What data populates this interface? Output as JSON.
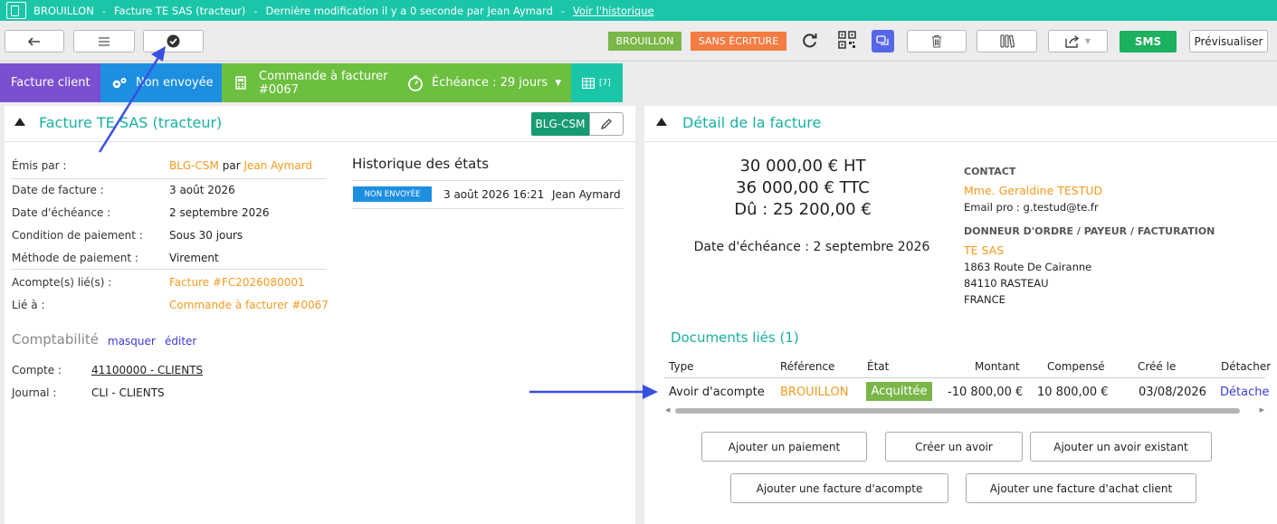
{
  "topbar": {
    "status": "BROUILLON",
    "sep1": "-",
    "title": "Facture TE SAS (tracteur)",
    "sep2": "-",
    "modified": "Dernière modification il y a 0 seconde par Jean Aymard",
    "sep3": "-",
    "history_link": "Voir l'historique"
  },
  "toolbar": {
    "badge_draft": "BROUILLON",
    "badge_no_write": "SANS ÉCRITURE",
    "sms": "SMS",
    "preview": "Prévisualiser",
    "colors": {
      "draft": "#7ab648",
      "no_write": "#f47b41",
      "sms": "#1bb15e",
      "chat": "#5567e8"
    }
  },
  "tabs": {
    "invoice_type": "Facture client",
    "send_state": "Non envoyée",
    "order_line1": "Commande à facturer",
    "order_line2": "#0067",
    "due": "Échéance : 29 jours",
    "grid_badge": "[7]",
    "colors": {
      "invoice_type": "#7b4fd1",
      "send_state": "#1d8fe0",
      "order": "#6cbf3f",
      "due": "#6cbf3f",
      "grid": "#1bc6a8"
    }
  },
  "left": {
    "title": "Facture TE SAS (tracteur)",
    "tag": "BLG-CSM",
    "fields": {
      "issued_by_label": "Émis par :",
      "issued_by_org": "BLG-CSM",
      "issued_by_par": "par",
      "issued_by_user": "Jean Aymard",
      "date_label": "Date de facture :",
      "date_value": "3 août 2026",
      "due_label": "Date d'échéance :",
      "due_value": "2 septembre 2026",
      "cond_label": "Condition de paiement :",
      "cond_value": "Sous 30 jours",
      "method_label": "Méthode de paiement :",
      "method_value": "Virement",
      "deposit_label": "Acompte(s) lié(s) :",
      "deposit_value": "Facture #FC2026080001",
      "linked_label": "Lié à :",
      "linked_value": "Commande à facturer #0067"
    },
    "history": {
      "title": "Historique des états",
      "badge": "NON ENVOYÉE",
      "date": "3 août 2026 16:21",
      "user": "Jean Aymard"
    },
    "accounting": {
      "title": "Comptabilité",
      "hide": "masquer",
      "edit": "éditer",
      "account_label": "Compte :",
      "account_value": "41100000 - CLIENTS",
      "journal_label": "Journal :",
      "journal_value": "CLI - CLIENTS"
    }
  },
  "right": {
    "title": "Détail de la facture",
    "ht": "30 000,00 € HT",
    "ttc": "36 000,00 € TTC",
    "due_amount": "Dû : 25 200,00 €",
    "due_date": "Date d'échéance : 2 septembre 2026",
    "contact_head": "CONTACT",
    "contact_name": "Mme. Geraldine TESTUD",
    "contact_email": "Email pro : g.testud@te.fr",
    "payer_head": "DONNEUR D'ORDRE / PAYEUR / FACTURATION",
    "payer_name": "TE SAS",
    "addr1": "1863 Route De Cairanne",
    "addr2": "84110 RASTEAU",
    "addr3": "FRANCE",
    "docs_title": "Documents liés (1)",
    "table": {
      "headers": [
        "Type",
        "Référence",
        "État",
        "Montant",
        "Compensé",
        "Créé le",
        "Détacher"
      ],
      "row": {
        "type": "Avoir d'acompte",
        "ref": "BROUILLON",
        "state": "Acquittée",
        "amount": "-10 800,00 €",
        "comp": "10 800,00 €",
        "created": "03/08/2026",
        "detach": "Détache"
      }
    },
    "buttons": {
      "add_payment": "Ajouter un paiement",
      "create_credit": "Créer un avoir",
      "add_existing_credit": "Ajouter un avoir existant",
      "add_deposit_invoice": "Ajouter une facture d'acompte",
      "add_purchase_invoice": "Ajouter une facture d'achat client"
    }
  }
}
